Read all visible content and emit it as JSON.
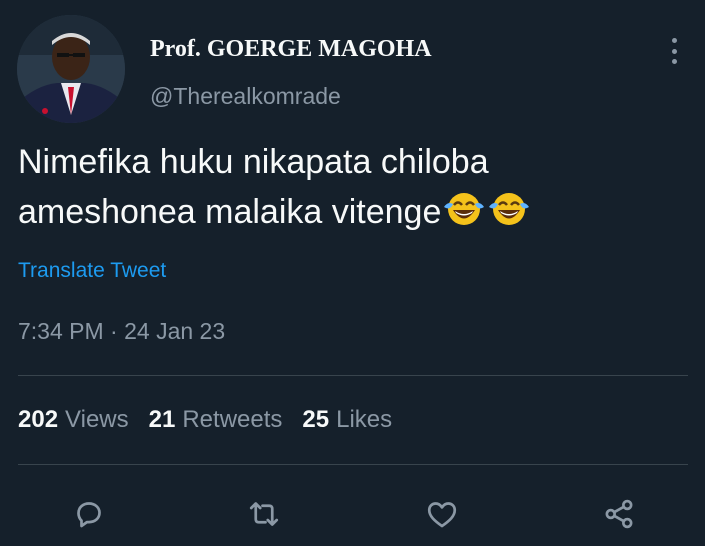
{
  "author": {
    "display_name": "Prof. GOERGE MAGOHA",
    "handle": "@Therealkomrade",
    "avatar_icon": "profile-photo-icon"
  },
  "tweet": {
    "text_line_1": "Nimefika huku nikapata chiloba",
    "text_line_2": "ameshonea malaika vitenge",
    "emojis": [
      "tears-of-joy-icon",
      "tears-of-joy-icon"
    ],
    "translate_label": "Translate Tweet",
    "timestamp": "7:34 PM · 24 Jan 23"
  },
  "stats": {
    "views_count": "202",
    "views_label": "Views",
    "retweets_count": "21",
    "retweets_label": "Retweets",
    "likes_count": "25",
    "likes_label": "Likes"
  },
  "actions": [
    "reply-icon",
    "retweet-icon",
    "like-icon",
    "share-icon"
  ],
  "colors": {
    "background": "#15202b",
    "text_primary": "#f7f9f9",
    "text_secondary": "#8b98a5",
    "link": "#1d9bf0",
    "divider": "#38444d"
  }
}
